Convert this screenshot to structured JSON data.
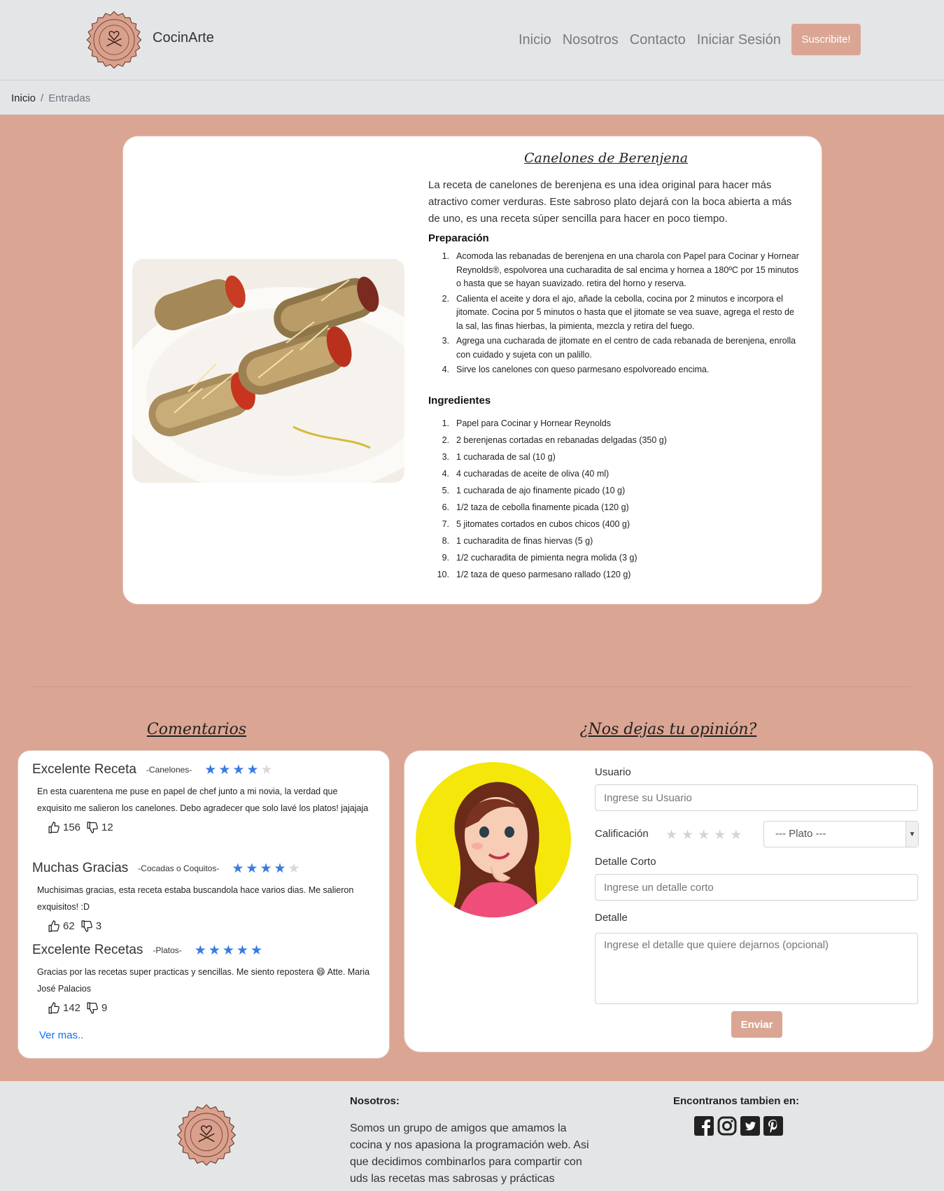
{
  "nav": {
    "brand": "CocinArte",
    "links": [
      "Inicio",
      "Nosotros",
      "Contacto",
      "Iniciar Sesión"
    ],
    "subscribe": "Suscribite!"
  },
  "breadcrumb": {
    "home": "Inicio",
    "separator": "/",
    "current": "Entradas"
  },
  "recipe": {
    "title": "Canelones de Berenjena",
    "intro": "La receta de canelones de berenjena es una idea original para hacer más atractivo comer verduras. Este sabroso plato dejará con la boca abierta a más de uno, es una receta súper sencilla para hacer en poco tiempo.",
    "steps_title": "Preparación",
    "steps": [
      "Acomoda las rebanadas de berenjena en una charola con Papel para Cocinar y Hornear Reynolds®, espolvorea una cucharadita de sal encima y hornea a 180ºC por 15 minutos o hasta que se hayan suavizado. retira del horno y reserva.",
      "Calienta el aceite y dora el ajo, añade la cebolla, cocina por 2 minutos e incorpora el jitomate. Cocina por 5 minutos o hasta que el jitomate se vea suave, agrega el resto de la sal, las finas hierbas, la pimienta, mezcla y retira del fuego.",
      "Agrega una cucharada de jitomate en el centro de cada rebanada de berenjena, enrolla con cuidado y sujeta con un palillo.",
      "Sirve los canelones con queso parmesano espolvoreado encima."
    ],
    "ingredients_title": "Ingredientes",
    "ingredients": [
      "Papel para Cocinar y Hornear Reynolds",
      "2 berenjenas cortadas en rebanadas delgadas (350 g)",
      "1 cucharada de sal (10 g)",
      "4 cucharadas de aceite de oliva (40 ml)",
      "1 cucharada de ajo finamente picado (10 g)",
      "1/2 taza de cebolla finamente picada (120 g)",
      "5 jitomates cortados en cubos chicos (400 g)",
      "1 cucharadita de finas hiervas (5 g)",
      "1/2 cucharadita de pimienta negra molida (3 g)",
      "1/2 taza de queso parmesano rallado (120 g)"
    ]
  },
  "comments": {
    "heading": "Comentarios",
    "items": [
      {
        "title": "Excelente Receta",
        "tag": "-Canelones-",
        "rating": 4,
        "body": "En esta cuarentena me puse en papel de chef junto a mi novia, la verdad que exquisito me salieron los canelones. Debo agradecer que solo lavé los platos! jajajaja",
        "likes": "156",
        "dislikes": "12"
      },
      {
        "title": "Muchas Gracias",
        "tag": "-Cocadas o Coquitos-",
        "rating": 4,
        "body": "Muchisimas gracias, esta receta estaba buscandola hace varios dias. Me salieron exquisitos! :D",
        "likes": "62",
        "dislikes": "3"
      },
      {
        "title": "Excelente Recetas",
        "tag": "-Platos-",
        "rating": 5,
        "body": "Gracias por las recetas super practicas y sencillas. Me siento repostera 😄 Atte. Maria José Palacios",
        "likes": "142",
        "dislikes": "9"
      }
    ],
    "see_more": "Ver mas.."
  },
  "form": {
    "heading": "¿Nos dejas tu opinión?",
    "user_label": "Usuario",
    "user_placeholder": "Ingrese su Usuario",
    "rating_label": "Calificación",
    "dish_selected": "--- Plato ---",
    "short_label": "Detalle Corto",
    "short_placeholder": "Ingrese un detalle corto",
    "detail_label": "Detalle",
    "detail_placeholder": "Ingrese el detalle que quiere dejarnos (opcional)",
    "submit": "Enviar"
  },
  "footer": {
    "about_title": "Nosotros:",
    "about_text": "Somos un grupo de amigos que amamos la cocina y nos apasiona la programación web. Asi que decidimos combinarlos para compartir con uds las recetas mas sabrosas y prácticas",
    "social_title": "Encontranos tambien en:",
    "social_icons": [
      "facebook-icon",
      "instagram-icon",
      "twitter-icon",
      "pinterest-icon"
    ]
  },
  "colors": {
    "accent": "#dba593",
    "navbar": "#e4e5e7",
    "star_on": "#3a7be0",
    "link": "#0d6efd"
  }
}
